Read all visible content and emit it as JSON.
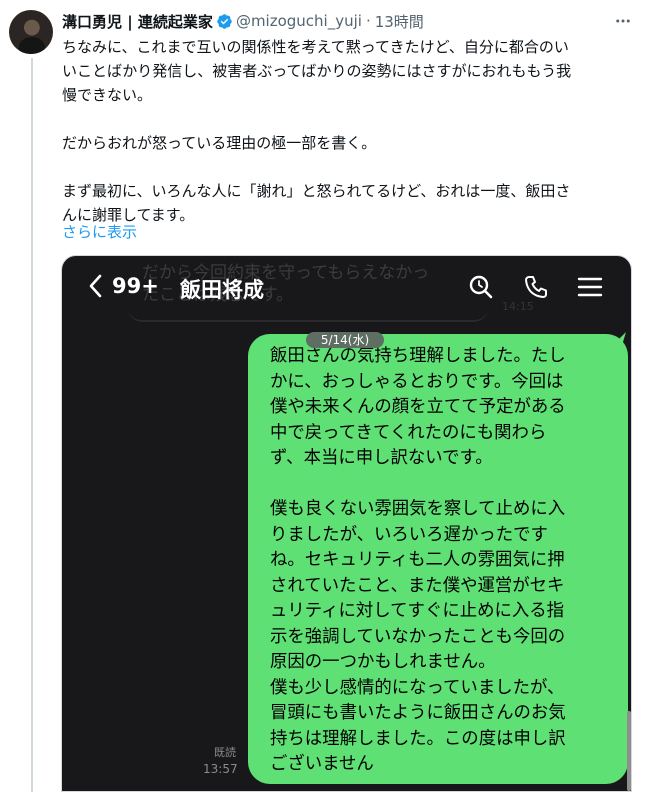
{
  "tweet": {
    "author_name": "溝口勇児 | 連続起業家",
    "handle": "@mizoguchi_yuji",
    "separator": "·",
    "time": "13時間",
    "paragraphs": [
      "ちなみに、これまで互いの関係性を考えて黙ってきたけど、自分に都合のい\nいことばかり発信し、被害者ぶってばかりの姿勢にはさすがにおれももう我\n慢できない。",
      "だからおれが怒っている理由の極一部を書く。",
      "まず最初に、いろんな人に「謝れ」と怒られてるけど、おれは一度、飯田さ\nんに謝罪してます。"
    ],
    "show_more": "さらに表示",
    "icons": {
      "more": "more-dots-icon",
      "verified": "verified-badge-icon"
    },
    "colors": {
      "link": "#1d9bf0",
      "verified": "#1d9bf0"
    }
  },
  "chat": {
    "unread_count": "99+",
    "contact_name": "飯田将成",
    "ghost_text": "だから今回約束を守ってもらえなかっ\nたことは残念です。",
    "ghost_time": "14:15",
    "date_label": "5/14(水)",
    "message_lines": [
      "飯田さんの気持ち理解しました。たし",
      "かに、おっしゃるとおりです。今回は",
      "僕や未来くんの顔を立てて予定がある",
      "中で戻ってきてくれたのにも関わら",
      "ず、本当に申し訳ないです。"
    ],
    "message_lines_2": [
      "僕も良くない雰囲気を察して止めに入",
      "りましたが、いろいろ遅かったです",
      "ね。セキュリティも二人の雰囲気に押",
      "されていたこと、また僕や運営がセキ",
      "ュリティに対してすぐに止めに入る指",
      "示を強調していなかったことも今回の",
      "原因の一つかもしれません。",
      "僕も少し感情的になっていましたが、",
      "冒頭にも書いたように飯田さんのお気",
      "持ちは理解しました。この度は申し訳",
      "ございません"
    ],
    "read_label": "既読",
    "sent_time": "13:57",
    "icons": [
      "back-arrow-icon",
      "search-icon",
      "phone-icon",
      "menu-icon"
    ],
    "colors": {
      "bubble": "#5fe074",
      "background": "#18181a"
    }
  }
}
